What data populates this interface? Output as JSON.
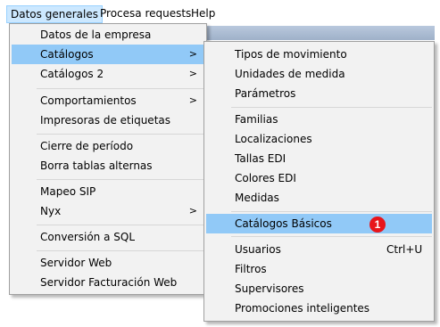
{
  "menubar": {
    "items": [
      {
        "label": "Datos generales"
      },
      {
        "label": "Procesa requests"
      },
      {
        "label": "Help"
      }
    ]
  },
  "main_menu": {
    "items": [
      {
        "label": "Datos de la empresa"
      },
      {
        "label": "Catálogos",
        "submenu_arrow": ">"
      },
      {
        "label": "Catálogos 2",
        "submenu_arrow": ">"
      },
      {
        "label": "Comportamientos",
        "submenu_arrow": ">"
      },
      {
        "label": "Impresoras de etiquetas"
      },
      {
        "label": "Cierre de período"
      },
      {
        "label": "Borra tablas alternas"
      },
      {
        "label": "Mapeo SIP"
      },
      {
        "label": "Nyx",
        "submenu_arrow": ">"
      },
      {
        "label": "Conversión a SQL"
      },
      {
        "label": "Servidor Web"
      },
      {
        "label": "Servidor Facturación Web"
      }
    ]
  },
  "sub_menu": {
    "items": [
      {
        "label": "Tipos de movimiento"
      },
      {
        "label": "Unidades de medida"
      },
      {
        "label": "Parámetros"
      },
      {
        "label": "Familias"
      },
      {
        "label": "Localizaciones"
      },
      {
        "label": "Tallas EDI"
      },
      {
        "label": "Colores EDI"
      },
      {
        "label": "Medidas"
      },
      {
        "label": "Catálogos Básicos"
      },
      {
        "label": "Usuarios",
        "shortcut": "Ctrl+U"
      },
      {
        "label": "Filtros"
      },
      {
        "label": "Supervisores"
      },
      {
        "label": "Promociones inteligentes"
      }
    ]
  },
  "annotation": {
    "label": "1",
    "color": "#e8151b"
  },
  "colors": {
    "menu_background": "#f2f2f2",
    "highlight": "#91c9f7",
    "menubar_active": "#cce8ff"
  },
  "icons": {
    "submenu_arrow": "chevron-right-icon"
  }
}
